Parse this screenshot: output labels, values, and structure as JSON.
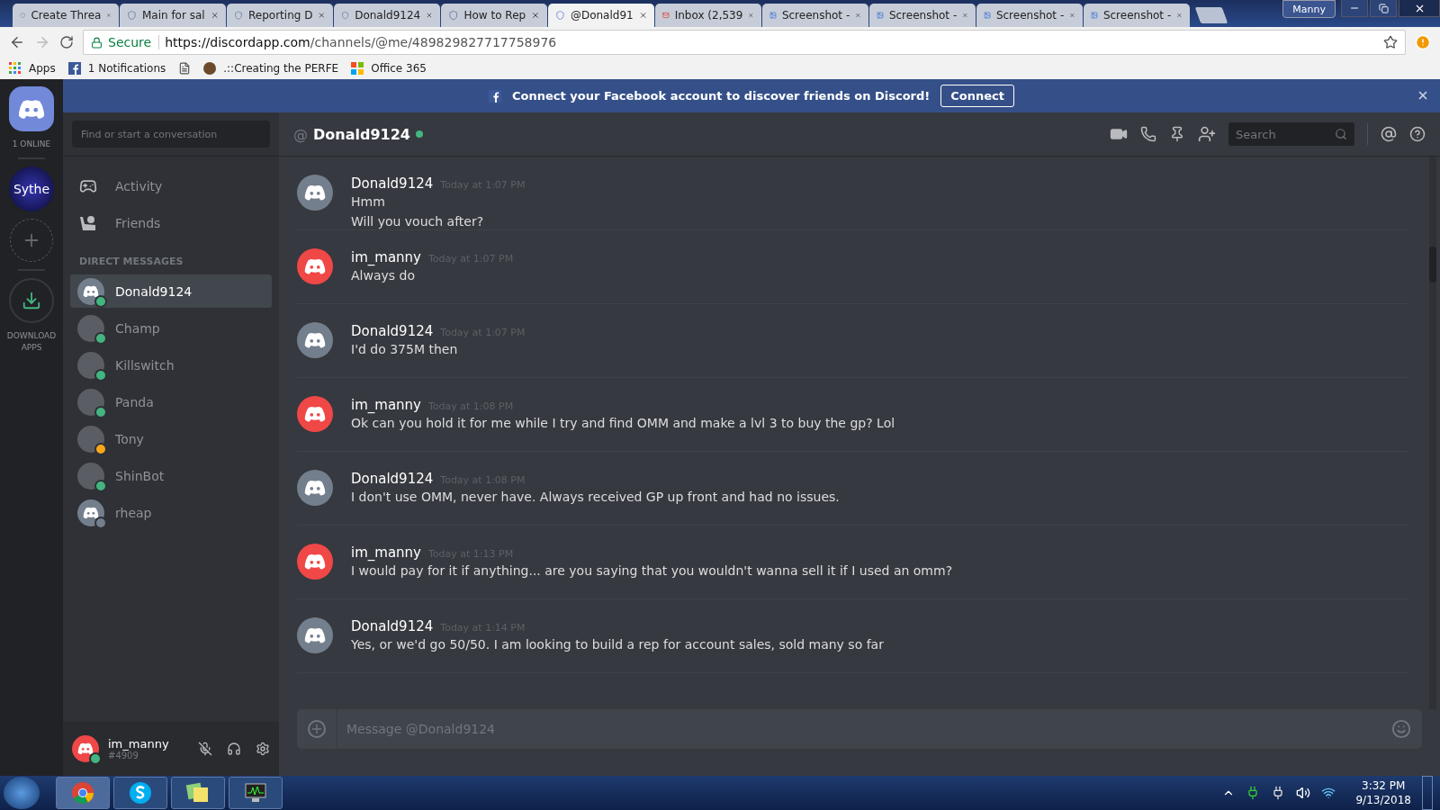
{
  "browser": {
    "tabs": [
      {
        "label": "Create Threa",
        "kind": "shield",
        "selected": false
      },
      {
        "label": "Main for sal",
        "kind": "shield",
        "selected": false
      },
      {
        "label": "Reporting D",
        "kind": "shield",
        "selected": false
      },
      {
        "label": "Donald9124",
        "kind": "shield",
        "selected": false
      },
      {
        "label": "How to Rep",
        "kind": "shield",
        "selected": false
      },
      {
        "label": "@Donald91",
        "kind": "chat",
        "selected": true
      },
      {
        "label": "Inbox (2,539",
        "kind": "mail",
        "selected": false
      },
      {
        "label": "Screenshot -",
        "kind": "picture",
        "selected": false
      },
      {
        "label": "Screenshot -",
        "kind": "picture",
        "selected": false
      },
      {
        "label": "Screenshot -",
        "kind": "picture",
        "selected": false
      },
      {
        "label": "Screenshot -",
        "kind": "picture",
        "selected": false
      }
    ],
    "profile": "Manny",
    "secure_label": "Secure",
    "url_host": "https://discordapp.com",
    "url_path": "/channels/@me/489829827717758976",
    "bookmarks": [
      {
        "label": "Apps",
        "kind": "apps"
      },
      {
        "label": "1 Notifications",
        "kind": "facebook"
      },
      {
        "kind": "page"
      },
      {
        "label": ".::Creating the PERFE",
        "kind": "badge"
      },
      {
        "label": "Office 365",
        "kind": "office"
      }
    ]
  },
  "servers": {
    "online_count": "1 ONLINE",
    "server_label": "Sythe",
    "download_label": "DOWNLOAD APPS"
  },
  "banner": {
    "text": "Connect your Facebook account to discover friends on Discord!",
    "button": "Connect"
  },
  "sidebar": {
    "search_placeholder": "Find or start a conversation",
    "nav": [
      {
        "label": "Activity",
        "kind": "gamepad"
      },
      {
        "label": "Friends",
        "kind": "friends"
      }
    ],
    "section_title": "DIRECT MESSAGES",
    "dms": [
      {
        "name": "Donald9124",
        "selected": true,
        "color": "#43b581",
        "kind": "logo"
      },
      {
        "name": "Champ",
        "selected": false,
        "color": "#43b581",
        "kind": "picture"
      },
      {
        "name": "Killswitch",
        "selected": false,
        "color": "#43b581",
        "kind": "picture"
      },
      {
        "name": "Panda",
        "selected": false,
        "color": "#43b581",
        "kind": "picture"
      },
      {
        "name": "Tony",
        "selected": false,
        "color": "#faa61a",
        "kind": "picture"
      },
      {
        "name": "ShinBot",
        "selected": false,
        "color": "#43b581",
        "kind": "picture"
      },
      {
        "name": "rheap",
        "selected": false,
        "color": "#747f8d",
        "kind": "logo"
      }
    ],
    "user": {
      "name": "im_manny",
      "tag": "#4909",
      "online": true,
      "muted": true
    }
  },
  "header": {
    "prefix": "@",
    "name": "Donald9124",
    "online": true,
    "search_placeholder": "Search"
  },
  "messages": [
    {
      "author": "Donald9124",
      "time": "Today at 1:07 PM",
      "color": "#747f8d",
      "lines": [
        "Hmm",
        "Will you vouch after?"
      ]
    },
    {
      "author": "im_manny",
      "time": "Today at 1:07 PM",
      "color": "#f04747",
      "lines": [
        "Always do"
      ]
    },
    {
      "author": "Donald9124",
      "time": "Today at 1:07 PM",
      "color": "#747f8d",
      "lines": [
        "I'd do 375M then"
      ]
    },
    {
      "author": "im_manny",
      "time": "Today at 1:08 PM",
      "color": "#f04747",
      "lines": [
        "Ok can you hold it for me while I try and find OMM and make a lvl 3 to buy the gp? Lol"
      ]
    },
    {
      "author": "Donald9124",
      "time": "Today at 1:08 PM",
      "color": "#747f8d",
      "lines": [
        "I don't use OMM, never have. Always received GP up front and had no issues."
      ]
    },
    {
      "author": "im_manny",
      "time": "Today at 1:13 PM",
      "color": "#f04747",
      "lines": [
        "I would pay for it if anything... are you saying that you wouldn't wanna sell it if I used an omm?"
      ]
    },
    {
      "author": "Donald9124",
      "time": "Today at 1:14 PM",
      "color": "#747f8d",
      "lines": [
        "Yes, or we'd go 50/50. I am looking to build a rep for account sales, sold many so far"
      ]
    }
  ],
  "composer": {
    "placeholder": "Message @Donald9124"
  },
  "taskbar": {
    "apps": [
      {
        "kind": "chrome",
        "selected": true
      },
      {
        "kind": "skype",
        "selected": false
      },
      {
        "kind": "notes",
        "selected": false
      },
      {
        "kind": "monitor",
        "selected": false
      }
    ],
    "time": "3:32 PM",
    "date": "9/13/2018"
  }
}
